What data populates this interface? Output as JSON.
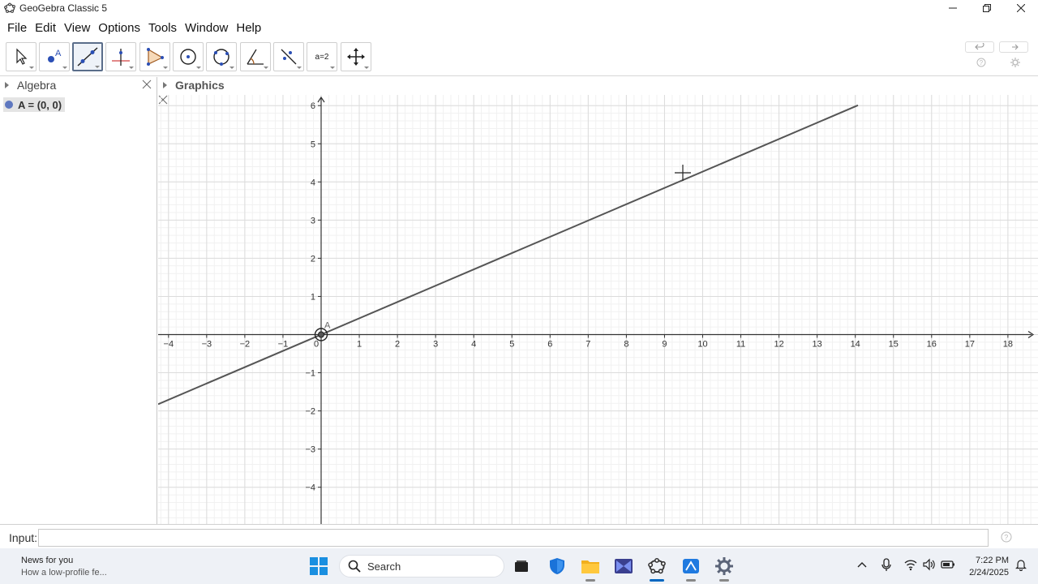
{
  "window": {
    "title": "GeoGebra Classic 5"
  },
  "menu": [
    "File",
    "Edit",
    "View",
    "Options",
    "Tools",
    "Window",
    "Help"
  ],
  "toolbar": {
    "tools": [
      {
        "name": "move-tool-icon",
        "active": false
      },
      {
        "name": "point-tool-icon",
        "active": false
      },
      {
        "name": "line-tool-icon",
        "active": true
      },
      {
        "name": "perpendicular-line-tool-icon",
        "active": false
      },
      {
        "name": "polygon-tool-icon",
        "active": false
      },
      {
        "name": "circle-center-point-tool-icon",
        "active": false
      },
      {
        "name": "circle-three-points-tool-icon",
        "active": false
      },
      {
        "name": "angle-tool-icon",
        "active": false
      },
      {
        "name": "reflect-tool-icon",
        "active": false
      },
      {
        "name": "slider-tool-icon",
        "active": false
      },
      {
        "name": "move-graphics-view-tool-icon",
        "active": false
      }
    ],
    "slider_label": "a=2"
  },
  "algebra": {
    "title": "Algebra",
    "objects": [
      {
        "text": "A = (0, 0)",
        "color": "#5f78c0"
      }
    ]
  },
  "graphics": {
    "title": "Graphics",
    "x_ticks": [
      "−4",
      "−3",
      "−2",
      "−1",
      "0",
      "1",
      "2",
      "3",
      "4",
      "5",
      "6",
      "7",
      "8",
      "9",
      "10",
      "11",
      "12",
      "13",
      "14",
      "15",
      "16",
      "17",
      "18"
    ],
    "y_ticks_pos": [
      "1",
      "2",
      "3",
      "4",
      "5",
      "6"
    ],
    "y_ticks_neg": [
      "−1",
      "−2",
      "−3",
      "−4"
    ],
    "point_label": "A",
    "line_color": "#555555"
  },
  "input": {
    "label": "Input:",
    "value": ""
  },
  "taskbar": {
    "news_title": "News for you",
    "news_sub": "How a low-profile fe...",
    "search_label": "Search",
    "time": "7:22 PM",
    "date": "2/24/2025"
  },
  "colors": {
    "accent": "#0067c0",
    "point": "#444444",
    "grid": "#e2e2e2"
  }
}
